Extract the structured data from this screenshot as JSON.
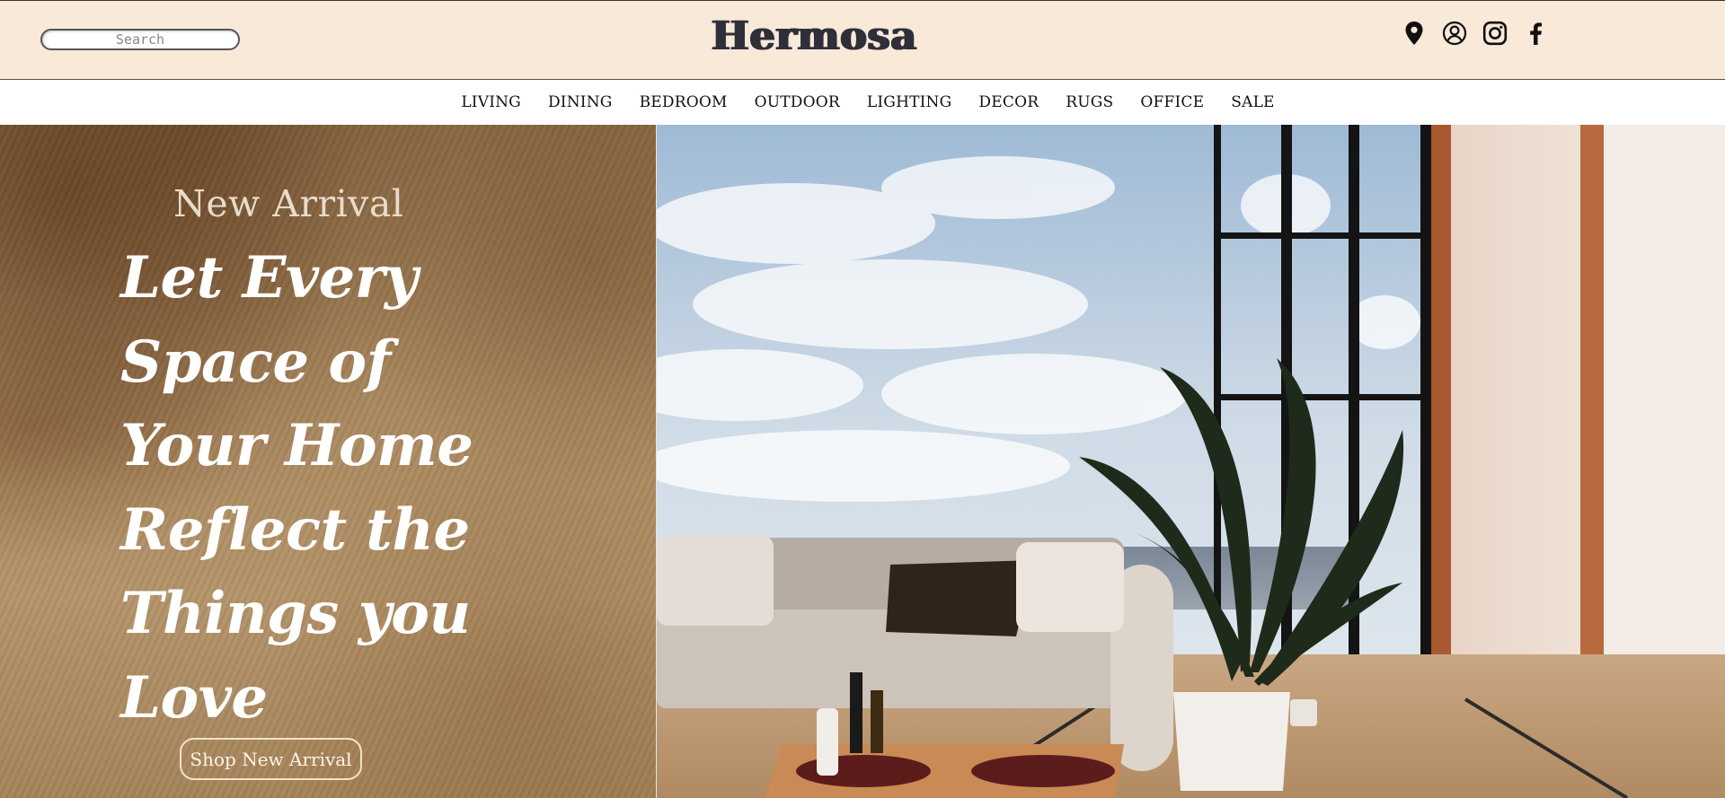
{
  "header": {
    "search_placeholder": "Search",
    "logo_text": "Hermosa",
    "icons": [
      "location-pin-icon",
      "user-account-icon",
      "instagram-icon",
      "facebook-icon"
    ]
  },
  "nav": {
    "items": [
      "LIVING",
      "DINING",
      "BEDROOM",
      "OUTDOOR",
      "LIGHTING",
      "DECOR",
      "RUGS",
      "OFFICE",
      "SALE"
    ]
  },
  "hero": {
    "eyebrow": "New Arrival",
    "headline_lines": [
      "Let Every",
      "Space of",
      "Your Home",
      "Reflect the",
      "Things you",
      "Love"
    ],
    "cta_label": "Shop New Arrival",
    "image_subject": "living room with sofa, plants and ocean view"
  },
  "colors": {
    "header_bg": "#f8e9d8",
    "logo": "#2f2f3a",
    "hero_left_bg": "#a8875e",
    "headline": "#ffffff",
    "nav_text": "#111111"
  }
}
